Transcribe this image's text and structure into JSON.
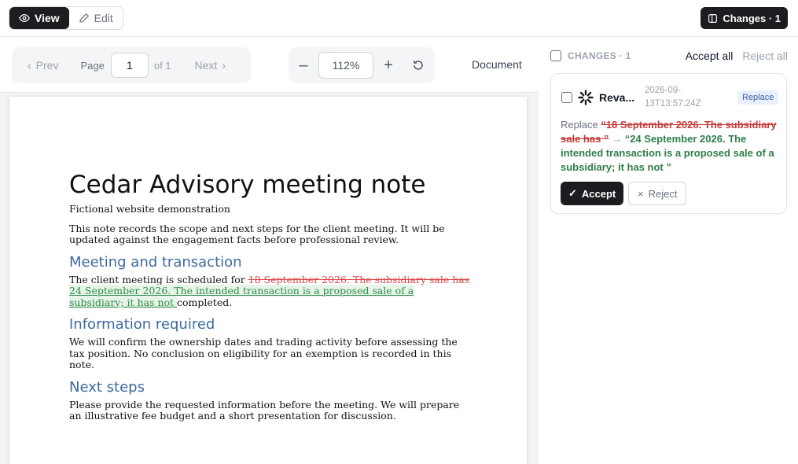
{
  "topbar": {
    "view_label": "View",
    "edit_label": "Edit",
    "changes_label": "Changes · 1"
  },
  "toolbar": {
    "prev_label": "Prev",
    "page_label": "Page",
    "page_value": "1",
    "of_label": "of 1",
    "next_label": "Next",
    "zoom_value": "112%",
    "mode_label": "Document"
  },
  "document": {
    "title": "Cedar Advisory meeting note",
    "subtitle": "Fictional website demonstration",
    "intro": "This note records the scope and next steps for the client meeting. It will be updated against the engagement facts before professional review.",
    "sections": [
      {
        "heading": "Meeting and transaction",
        "before": "The client meeting is scheduled for ",
        "deleted": "18 September 2026. The subsidiary sale has ",
        "inserted": "24 September 2026. The intended transaction is a proposed sale of a subsidiary; it has not ",
        "after": "completed."
      },
      {
        "heading": "Information required",
        "text": "We will confirm the ownership dates and trading activity before assessing the tax position. No conclusion on eligibility for an exemption is recorded in this note."
      },
      {
        "heading": "Next steps",
        "text": "Please provide the requested information before the meeting. We will prepare an illustrative fee budget and a short presentation for discussion."
      }
    ]
  },
  "changes_panel": {
    "header_label": "CHANGES · 1",
    "accept_all_label": "Accept all",
    "reject_all_label": "Reject all",
    "changes": [
      {
        "author": "Reva...",
        "timestamp": "2026-09-13T13:57:24Z",
        "kind": "Replace",
        "action_word": "Replace",
        "old_text": "“18 September 2026. The subsidiary sale has ”",
        "new_text": "“24 September 2026. The intended transaction is a proposed sale of a subsidiary; it has not ”",
        "accept_label": "Accept",
        "reject_label": "Reject"
      }
    ]
  },
  "colors": {
    "accent_dark": "#1b1d21",
    "deleted": "#e0474a",
    "inserted": "#2f8a4a",
    "heading": "#3d6a9f"
  }
}
